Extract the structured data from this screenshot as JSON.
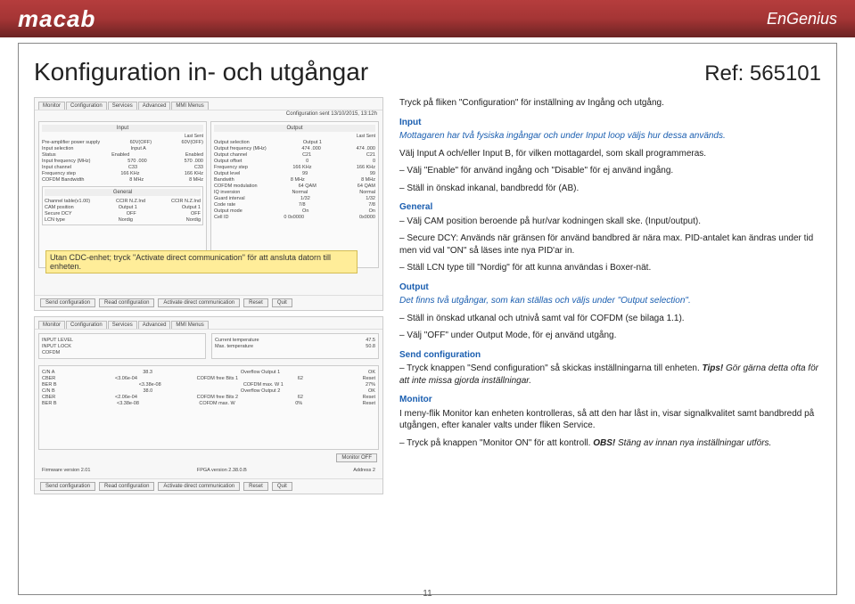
{
  "brand": {
    "left": "macab",
    "right": "EnGenius"
  },
  "title": "Konfiguration in- och utgångar",
  "ref": "Ref: 565101",
  "intro": "Tryck på fliken \"Configuration\" för inställning av Ingång och utgång.",
  "input": {
    "heading": "Input",
    "lead": "Mottagaren har två fysiska ingångar och under Input loop väljs hur dessa används.",
    "p1": "Välj Input A och/eller Input B, för vilken mottagardel, som skall programmeras.",
    "b1": "– Välj \"Enable\" för använd ingång och \"Disable\" för ej använd ingång.",
    "b2": "– Ställ in önskad inkanal, bandbredd för (AB)."
  },
  "general": {
    "heading": "General",
    "b1": "– Välj CAM position beroende på hur/var kodningen skall ske. (Input/output).",
    "b2": "– Secure DCY: Används när gränsen för använd bandbred är nära max. PID-antalet kan ändras under tid men vid val \"ON\" så läses inte nya PID'ar in.",
    "b3": "– Ställ LCN type till \"Nordig\" för att kunna användas i Boxer-nät."
  },
  "output": {
    "heading": "Output",
    "lead": "Det finns två utgångar, som kan ställas och väljs under \"Output selection\".",
    "b1": "– Ställ in önskad utkanal och utnivå samt val för COFDM (se bilaga 1.1).",
    "b2": "– Välj \"OFF\" under Output Mode, för ej använd utgång."
  },
  "send": {
    "heading": "Send configuration",
    "p1": "– Tryck knappen \"Send configuration\" så skickas inställningarna till enheten. ",
    "tips_label": "Tips!",
    "tips_text": " Gör gärna detta ofta för att inte missa gjorda inställningar."
  },
  "monitor": {
    "heading": "Monitor",
    "p1": "I meny-flik Monitor kan enheten kontrolleras, så att den har låst in, visar signalkvalitet samt bandbredd på utgången, efter kanaler valts under fliken Service.",
    "b1": "– Tryck på knappen \"Monitor ON\" för att kontroll. ",
    "obs_label": "OBS!",
    "obs_text": " Stäng av innan nya inställningar utförs."
  },
  "callout": "Utan CDC-enhet; tryck \"Activate direct communication\" för att ansluta datorn till enheten.",
  "page_num": "11",
  "shot1": {
    "tabs": [
      "Monitor",
      "Configuration",
      "Services",
      "Advanced",
      "MMI Menus"
    ],
    "sent_line": "Configuration sent 13/10/2015, 13:12h",
    "input_title": "Input",
    "output_title": "Output",
    "general_title": "General",
    "last_sent": "Last Sent",
    "input_rows": [
      [
        "Pre-amplifier power supply",
        "60V(OFF)",
        "60V(OFF)"
      ],
      [
        "Input selection",
        "Input A",
        ""
      ],
      [
        "Status",
        "Enabled",
        "Enabled"
      ],
      [
        "Input frequency (MHz)",
        "570    .000",
        "570    .000"
      ],
      [
        "Input channel",
        "C33",
        "C33"
      ],
      [
        "Frequency step",
        "166 KHz",
        "166 KHz"
      ],
      [
        "COFDM Bandwidth",
        "8 MHz",
        "8 MHz"
      ]
    ],
    "general_rows": [
      [
        "Channel table(v1.00)",
        "CCIR N.Z.Ind",
        "CCIR N.Z.Ind"
      ],
      [
        "CAM position",
        "Output 1",
        "Output 1"
      ],
      [
        "Secure DCY",
        "OFF",
        "OFF"
      ],
      [
        "LCN type",
        "Nordig",
        "Nordig"
      ]
    ],
    "output_rows": [
      [
        "Output selection",
        "Output 1",
        ""
      ],
      [
        "Output frequency (MHz)",
        "474   .000",
        "474   .000"
      ],
      [
        "Output channel",
        "C21",
        "C21"
      ],
      [
        "Output offset",
        "0",
        "0"
      ],
      [
        "Frequency step",
        "166 KHz",
        "166 KHz"
      ],
      [
        "Output level",
        "99",
        "99"
      ],
      [
        "Bandwith",
        "8 MHz",
        "8 MHz"
      ],
      [
        "COFDM modulation",
        "64 QAM",
        "64 QAM"
      ],
      [
        "IQ inversion",
        "Normal",
        "Normal"
      ],
      [
        "Guard interval",
        "1/32",
        "1/32"
      ],
      [
        "Code rate",
        "7/8",
        "7/8"
      ],
      [
        "Output mode",
        "On",
        "On"
      ],
      [
        "Cell ID",
        "0      0x0000",
        "0x0000"
      ]
    ],
    "buttons": [
      "Send configuration",
      "Read configuration",
      "Activate direct communication",
      "Reset",
      "Quit"
    ]
  },
  "shot2": {
    "tabs": [
      "Monitor",
      "Configuration",
      "Services",
      "Advanced",
      "MMI Menus"
    ],
    "left_rows": [
      [
        "INPUT LEVEL",
        ""
      ],
      [
        "INPUT LOCK",
        ""
      ],
      [
        "COFDM",
        ""
      ]
    ],
    "right_rows": [
      [
        "Current temperature",
        "47.5"
      ],
      [
        "Max. temperature",
        "50.8"
      ]
    ],
    "chan_rows": [
      [
        "C/N A",
        "38.3",
        "Overflow Output 1",
        "OK"
      ],
      [
        "CBER",
        "<3.06e-04",
        "COFDM free Bits 1",
        "62",
        "Reset"
      ],
      [
        "BER B",
        "<3.38e-08",
        "COFDM max. W 1",
        "27%"
      ],
      [
        "C/N B",
        "38.0",
        "Overflow Output 2",
        "OK"
      ],
      [
        "CBER",
        "<2.06e-04",
        "COFDM free Bits 2",
        "62",
        "Reset"
      ],
      [
        "BER B",
        "<3.38e-08",
        "COFDM max. W",
        "0%",
        "Reset"
      ]
    ],
    "monitor_btn": "Monitor OFF",
    "footer": [
      "Firmware version 2.01",
      "FPGA version 2.38.0.B",
      "Address 2"
    ],
    "buttons": [
      "Send configuration",
      "Read configuration",
      "Activate direct communication",
      "Reset",
      "Quit"
    ]
  }
}
